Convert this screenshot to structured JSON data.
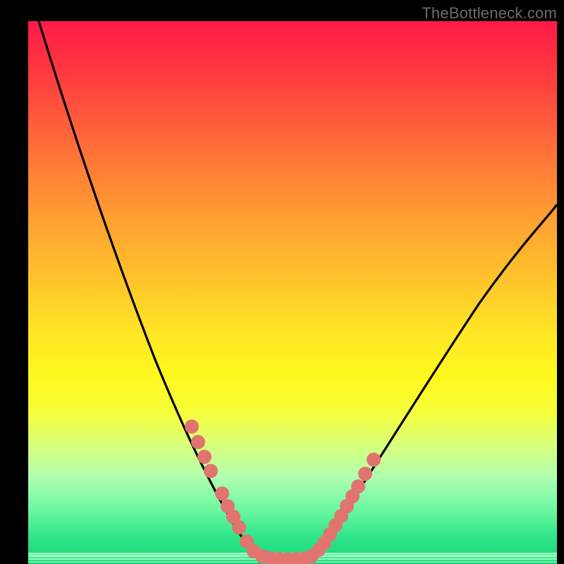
{
  "watermark": "TheBottleneck.com",
  "chart_data": {
    "type": "line",
    "title": "",
    "xlabel": "",
    "ylabel": "",
    "xlim": [
      0,
      100
    ],
    "ylim": [
      0,
      100
    ],
    "grid": false,
    "legend": false,
    "background_gradient": {
      "direction": "vertical",
      "stops": [
        {
          "pos": 0,
          "color": "#ff1a49"
        },
        {
          "pos": 50,
          "color": "#ffe824"
        },
        {
          "pos": 80,
          "color": "#b0ffb0"
        },
        {
          "pos": 100,
          "color": "#14d67b"
        }
      ]
    },
    "series": [
      {
        "name": "bottleneck-curve",
        "color": "#000000",
        "x": [
          2,
          6,
          10,
          14,
          18,
          22,
          26,
          30,
          34,
          37,
          40,
          42,
          44,
          46,
          48,
          50,
          52,
          55,
          60,
          66,
          74,
          84,
          95,
          100
        ],
        "y": [
          100,
          86,
          73,
          61,
          50,
          41,
          33,
          26,
          20,
          14,
          9,
          5,
          2,
          0.5,
          0,
          0.5,
          2,
          6,
          14,
          25,
          38,
          52,
          64,
          68
        ]
      },
      {
        "name": "highlight-dots-left",
        "type": "scatter",
        "color": "#e1746f",
        "x": [
          30,
          31.5,
          33,
          34.5,
          37,
          38,
          39,
          40,
          42,
          44
        ],
        "y": [
          26,
          23,
          20,
          17.5,
          14,
          12,
          10,
          8.5,
          5,
          2
        ]
      },
      {
        "name": "highlight-dots-right",
        "type": "scatter",
        "color": "#e1746f",
        "x": [
          52,
          53,
          54,
          55,
          56,
          57,
          58,
          59,
          60,
          62
        ],
        "y": [
          2,
          3.5,
          5,
          6.5,
          8,
          10,
          12,
          14,
          16,
          19
        ]
      },
      {
        "name": "valley-band",
        "type": "scatter",
        "color": "#e1746f",
        "x": [
          44,
          45,
          46,
          47,
          48,
          49,
          50,
          51,
          52
        ],
        "y": [
          1,
          0.6,
          0.3,
          0.2,
          0.2,
          0.2,
          0.3,
          0.6,
          1
        ]
      }
    ],
    "annotations": []
  }
}
